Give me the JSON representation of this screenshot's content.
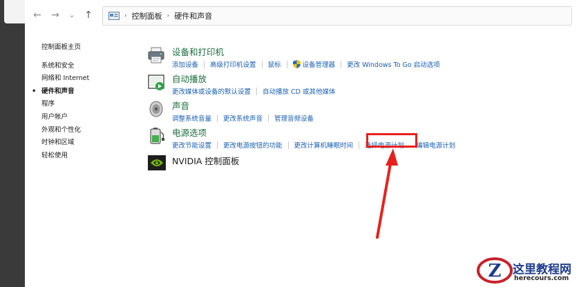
{
  "nav": {
    "back_glyph": "←",
    "forward_glyph": "→",
    "recent_glyph": "⌄",
    "up_glyph": "↑",
    "breadcrumb": [
      "控制面板",
      "硬件和声音"
    ],
    "crumb_sep": "›"
  },
  "sidebar": {
    "home": "控制面板主页",
    "items": [
      {
        "label": "系统和安全",
        "active": false
      },
      {
        "label": "网络和 Internet",
        "active": false
      },
      {
        "label": "硬件和声音",
        "active": true
      },
      {
        "label": "程序",
        "active": false
      },
      {
        "label": "用户帐户",
        "active": false
      },
      {
        "label": "外观和个性化",
        "active": false
      },
      {
        "label": "时钟和区域",
        "active": false
      },
      {
        "label": "轻松使用",
        "active": false
      }
    ],
    "active_marker": "•"
  },
  "categories": [
    {
      "icon": "printer-icon",
      "title": "设备和打印机",
      "links": [
        "添加设备",
        "高级打印机设置",
        "鼠标",
        "设备管理器",
        "更改 Windows To Go 启动选项"
      ]
    },
    {
      "icon": "autoplay-icon",
      "title": "自动播放",
      "links": [
        "更改媒体或设备的默认设置",
        "自动播放 CD 或其他媒体"
      ]
    },
    {
      "icon": "speaker-icon",
      "title": "声音",
      "links": [
        "调整系统音量",
        "更改系统声音",
        "管理音频设备"
      ]
    },
    {
      "icon": "battery-icon",
      "title": "电源选项",
      "links": [
        "更改节能设置",
        "更改电源按钮的功能",
        "更改计算机睡眠时间",
        "选择电源计划",
        "编辑电源计划"
      ]
    },
    {
      "icon": "nvidia-icon",
      "title": "NVIDIA 控制面板",
      "links": []
    }
  ],
  "colors": {
    "category_title": "#1b6e3c",
    "link": "#1a5fb4",
    "highlight": "#e8201c"
  },
  "watermark": {
    "title": "这里教程网",
    "url": "herecours.com",
    "logo_letter": "Z"
  }
}
